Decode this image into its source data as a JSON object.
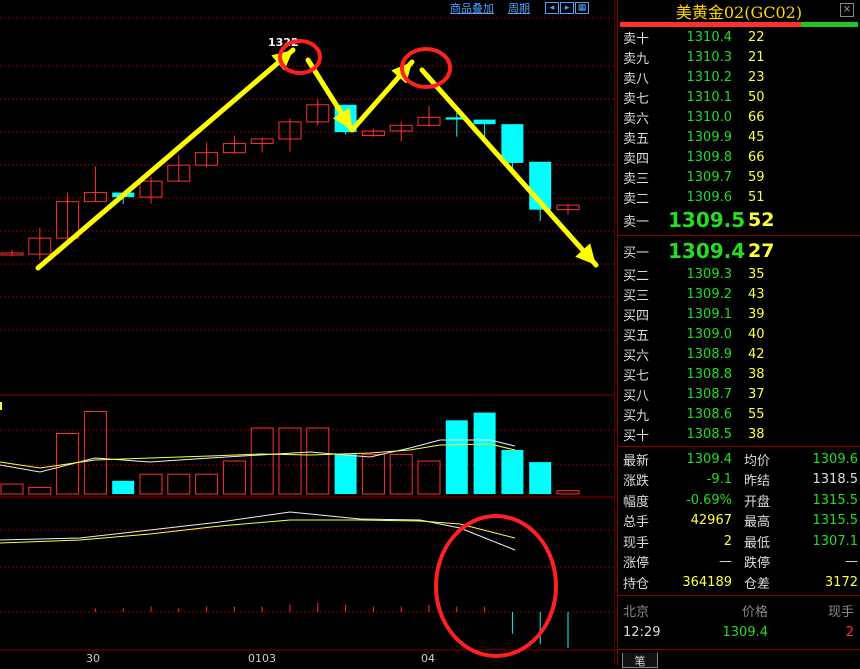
{
  "top_links": {
    "overlay": "商品叠加",
    "period": "周期"
  },
  "chart_annotation": "1322",
  "x_labels": [
    "30",
    "0103",
    "04"
  ],
  "panel": {
    "title": "美黄金02(GC02)",
    "asks": [
      {
        "label": "卖十",
        "price": "1310.4",
        "vol": "22"
      },
      {
        "label": "卖九",
        "price": "1310.3",
        "vol": "21"
      },
      {
        "label": "卖八",
        "price": "1310.2",
        "vol": "23"
      },
      {
        "label": "卖七",
        "price": "1310.1",
        "vol": "50"
      },
      {
        "label": "卖六",
        "price": "1310.0",
        "vol": "66"
      },
      {
        "label": "卖五",
        "price": "1309.9",
        "vol": "45"
      },
      {
        "label": "卖四",
        "price": "1309.8",
        "vol": "66"
      },
      {
        "label": "卖三",
        "price": "1309.7",
        "vol": "59"
      },
      {
        "label": "卖二",
        "price": "1309.6",
        "vol": "51"
      },
      {
        "label": "卖一",
        "price": "1309.5",
        "vol": "52"
      }
    ],
    "bids": [
      {
        "label": "买一",
        "price": "1309.4",
        "vol": "27"
      },
      {
        "label": "买二",
        "price": "1309.3",
        "vol": "35"
      },
      {
        "label": "买三",
        "price": "1309.2",
        "vol": "43"
      },
      {
        "label": "买四",
        "price": "1309.1",
        "vol": "39"
      },
      {
        "label": "买五",
        "price": "1309.0",
        "vol": "40"
      },
      {
        "label": "买六",
        "price": "1308.9",
        "vol": "42"
      },
      {
        "label": "买七",
        "price": "1308.8",
        "vol": "38"
      },
      {
        "label": "买八",
        "price": "1308.7",
        "vol": "37"
      },
      {
        "label": "买九",
        "price": "1308.6",
        "vol": "55"
      },
      {
        "label": "买十",
        "price": "1308.5",
        "vol": "38"
      }
    ],
    "stats": [
      {
        "l1": "最新",
        "v1": "1309.4",
        "l2": "均价",
        "v2": "1309.6"
      },
      {
        "l1": "涨跌",
        "v1": "-9.1",
        "l2": "昨结",
        "v2": "1318.5"
      },
      {
        "l1": "幅度",
        "v1": "-0.69%",
        "l2": "开盘",
        "v2": "1315.5"
      },
      {
        "l1": "总手",
        "v1": "42967",
        "l2": "最高",
        "v2": "1315.5"
      },
      {
        "l1": "现手",
        "v1": "2",
        "l2": "最低",
        "v2": "1307.1"
      },
      {
        "l1": "涨停",
        "v1": "—",
        "l2": "跌停",
        "v2": "—"
      },
      {
        "l1": "持仓",
        "v1": "364189",
        "l2": "仓差",
        "v2": "3172"
      }
    ],
    "tick_header": {
      "c1": "北京",
      "c2": "价格",
      "c3": "现手"
    },
    "tick": {
      "time": "12:29",
      "price": "1309.4",
      "qty": "2"
    },
    "tab": "笔"
  },
  "colors": {
    "up": "#ff3030",
    "down": "#00ffff",
    "arrow": "#ffff00",
    "circle": "#ff2020",
    "grid": "#8b0000"
  },
  "candles": [
    {
      "o": 1309.3,
      "h": 1309.6,
      "l": 1309.0,
      "c": 1309.3
    },
    {
      "o": 1309.2,
      "h": 1311.5,
      "l": 1308.7,
      "c": 1310.6
    },
    {
      "o": 1310.6,
      "h": 1314.6,
      "l": 1310.0,
      "c": 1313.8
    },
    {
      "o": 1313.8,
      "h": 1316.9,
      "l": 1313.8,
      "c": 1314.6
    },
    {
      "o": 1314.6,
      "h": 1314.6,
      "l": 1313.6,
      "c": 1314.2
    },
    {
      "o": 1314.2,
      "h": 1316.0,
      "l": 1313.6,
      "c": 1315.6
    },
    {
      "o": 1315.6,
      "h": 1317.9,
      "l": 1315.6,
      "c": 1317.0
    },
    {
      "o": 1317.0,
      "h": 1319.0,
      "l": 1316.8,
      "c": 1318.1
    },
    {
      "o": 1318.1,
      "h": 1319.6,
      "l": 1318.0,
      "c": 1318.9
    },
    {
      "o": 1318.9,
      "h": 1319.4,
      "l": 1318.1,
      "c": 1319.3
    },
    {
      "o": 1319.3,
      "h": 1321.1,
      "l": 1318.2,
      "c": 1320.8
    },
    {
      "o": 1320.8,
      "h": 1322.8,
      "l": 1320.5,
      "c": 1322.3
    },
    {
      "o": 1322.3,
      "h": 1322.3,
      "l": 1319.7,
      "c": 1319.9
    },
    {
      "o": 1319.6,
      "h": 1320.2,
      "l": 1319.5,
      "c": 1320.0
    },
    {
      "o": 1320.0,
      "h": 1320.8,
      "l": 1319.1,
      "c": 1320.5
    },
    {
      "o": 1320.5,
      "h": 1322.2,
      "l": 1320.4,
      "c": 1321.2
    },
    {
      "o": 1321.2,
      "h": 1321.6,
      "l": 1319.5,
      "c": 1321.0
    },
    {
      "o": 1321.0,
      "h": 1321.0,
      "l": 1319.4,
      "c": 1320.6
    },
    {
      "o": 1320.6,
      "h": 1320.6,
      "l": 1316.3,
      "c": 1317.2
    },
    {
      "o": 1317.3,
      "h": 1317.3,
      "l": 1312.1,
      "c": 1313.1
    },
    {
      "o": 1313.1,
      "h": 1313.6,
      "l": 1312.7,
      "c": 1313.5
    }
  ],
  "volumes": [
    9,
    6,
    55,
    75,
    12,
    18,
    18,
    18,
    30,
    60,
    60,
    60,
    36,
    36,
    36,
    30,
    67,
    74,
    40,
    29,
    3
  ],
  "macd": [
    0,
    0,
    0,
    0.2,
    0.2,
    0.3,
    0.2,
    0.3,
    0.3,
    0.3,
    0.4,
    0.5,
    0.4,
    0.3,
    0.3,
    0.4,
    0.3,
    0.3,
    -0.6,
    -0.9,
    -1.0
  ]
}
